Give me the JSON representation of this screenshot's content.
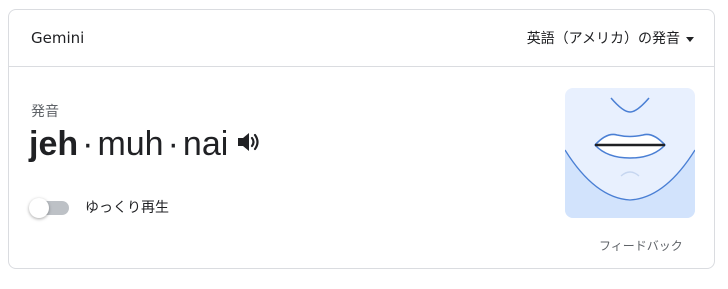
{
  "header": {
    "word": "Gemini",
    "language_select": "英語（アメリカ）の発音"
  },
  "pronunciation": {
    "label": "発音",
    "syllables": [
      {
        "text": "jeh",
        "stressed": true
      },
      {
        "text": "muh",
        "stressed": false
      },
      {
        "text": "nai",
        "stressed": false
      }
    ],
    "separator": "·"
  },
  "slow_playback": {
    "label": "ゆっくり再生",
    "enabled": false
  },
  "feedback_label": "フィードバック",
  "icons": {
    "speaker": "speaker-icon",
    "dropdown": "caret-down-icon"
  },
  "colors": {
    "mouth_background": "#e8f0fe",
    "mouth_lower": "#d2e3fc",
    "mouth_line": "#4a7fd4"
  }
}
